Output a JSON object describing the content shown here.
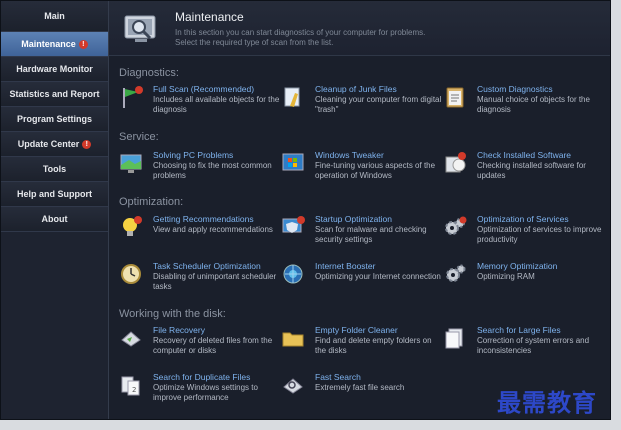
{
  "nav": [
    {
      "label": "Main"
    },
    {
      "label": "Maintenance",
      "badge": "!"
    },
    {
      "label": "Hardware Monitor"
    },
    {
      "label": "Statistics and Report"
    },
    {
      "label": "Program Settings"
    },
    {
      "label": "Update Center",
      "badge": "!"
    },
    {
      "label": "Tools"
    },
    {
      "label": "Help and Support"
    },
    {
      "label": "About"
    }
  ],
  "header": {
    "title": "Maintenance",
    "desc1": "In this section you can start diagnostics of your computer for problems.",
    "desc2": "Select the required type of scan from the list."
  },
  "sections": [
    {
      "label": "Diagnostics:"
    },
    {
      "label": "Service:"
    },
    {
      "label": "Optimization:"
    },
    {
      "label": "Working with the disk:"
    }
  ],
  "items": [
    {
      "title": "Full Scan (Recommended)",
      "desc": "Includes all available objects for the diagnosis",
      "icon": "flag-icon"
    },
    {
      "title": "Cleanup of Junk Files",
      "desc": "Cleaning your computer from digital \"trash\"",
      "icon": "broom-icon"
    },
    {
      "title": "Custom Diagnostics",
      "desc": "Manual choice of objects for the diagnosis",
      "icon": "clipboard-icon"
    },
    {
      "title": "Solving PC Problems",
      "desc": "Choosing to fix the most common problems",
      "icon": "monitor-icon"
    },
    {
      "title": "Windows Tweaker",
      "desc": "Fine-tuning various aspects of the operation of Windows",
      "icon": "windows-icon"
    },
    {
      "title": "Check Installed Software",
      "desc": "Checking installed software for updates",
      "icon": "software-box-icon"
    },
    {
      "title": "Getting Recommendations",
      "desc": "View and apply recommendations",
      "icon": "lightbulb-icon"
    },
    {
      "title": "Startup Optimization",
      "desc": "Scan for malware and checking security settings",
      "icon": "shield-monitor-icon"
    },
    {
      "title": "Optimization of Services",
      "desc": "Optimization of services to improve productivity",
      "icon": "gears-icon"
    },
    {
      "title": "Task Scheduler Optimization",
      "desc": "Disabling of unimportant scheduler tasks",
      "icon": "clock-icon"
    },
    {
      "title": "Internet Booster",
      "desc": "Optimizing your Internet connection",
      "icon": "globe-icon"
    },
    {
      "title": "Memory Optimization",
      "desc": "Optimizing RAM",
      "icon": "memory-icon"
    },
    {
      "title": "File Recovery",
      "desc": "Recovery of deleted files from the computer or disks",
      "icon": "recovery-disk-icon"
    },
    {
      "title": "Empty Folder Cleaner",
      "desc": "Find and delete empty folders on the disks",
      "icon": "folder-icon"
    },
    {
      "title": "Search for Large Files",
      "desc": "Correction of system errors and inconsistencies",
      "icon": "files-icon"
    },
    {
      "title": "Search for Duplicate Files",
      "desc": "Optimize Windows settings to improve performance",
      "icon": "duplicate-files-icon"
    },
    {
      "title": "Fast Search",
      "desc": "Extremely fast file search",
      "icon": "search-disk-icon"
    }
  ],
  "watermark": "最需教育",
  "colors": {
    "accent": "#4a6fa5",
    "link": "#7fb3ee",
    "badge": "#d23a2a"
  }
}
